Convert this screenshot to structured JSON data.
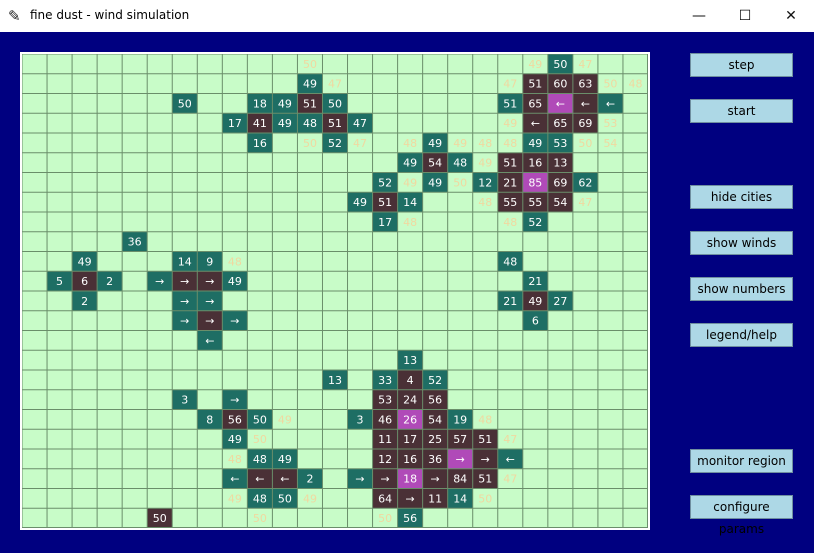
{
  "window": {
    "title": "fine dust - wind simulation",
    "icon": "feather-icon",
    "controls": [
      "minimize-icon",
      "maximize-icon",
      "close-icon"
    ]
  },
  "buttons": {
    "step": "step",
    "start": "start",
    "hide_cities": "hide cities",
    "show_winds": "show winds",
    "show_numbers": "show numbers",
    "legend_help": "legend/help",
    "monitor_region": "monitor region",
    "configure_params": "configure params"
  },
  "grid": {
    "rows": 19,
    "cols": 25,
    "colors": {
      "empty": "#c8fcc8",
      "teal": "#1e6e64",
      "dark": "#4a3036",
      "magenta": "#b04ab8",
      "line": "#6a8e6a",
      "text": "#ffffff",
      "faint": "#f0d8a0"
    },
    "cells": [
      [
        0,
        11,
        "f",
        "50"
      ],
      [
        0,
        20,
        "f",
        "49"
      ],
      [
        0,
        21,
        "t",
        "50"
      ],
      [
        0,
        22,
        "f",
        "47"
      ],
      [
        1,
        11,
        "t",
        "49"
      ],
      [
        1,
        12,
        "f",
        "47"
      ],
      [
        1,
        19,
        "f",
        "47"
      ],
      [
        1,
        20,
        "d",
        "51"
      ],
      [
        1,
        21,
        "d",
        "60"
      ],
      [
        1,
        22,
        "d",
        "63"
      ],
      [
        1,
        23,
        "f",
        "50"
      ],
      [
        1,
        24,
        "f",
        "48"
      ],
      [
        2,
        6,
        "t",
        "50"
      ],
      [
        2,
        9,
        "t",
        "18"
      ],
      [
        2,
        10,
        "t",
        "49"
      ],
      [
        2,
        11,
        "d",
        "51"
      ],
      [
        2,
        12,
        "t",
        "50"
      ],
      [
        2,
        19,
        "t",
        "51"
      ],
      [
        2,
        20,
        "d",
        "65"
      ],
      [
        2,
        21,
        "m",
        "←"
      ],
      [
        2,
        22,
        "d",
        "←"
      ],
      [
        2,
        23,
        "t",
        "←"
      ],
      [
        3,
        8,
        "t",
        "17"
      ],
      [
        3,
        9,
        "d",
        "41"
      ],
      [
        3,
        10,
        "t",
        "49"
      ],
      [
        3,
        11,
        "t",
        "48"
      ],
      [
        3,
        12,
        "d",
        "51"
      ],
      [
        3,
        13,
        "t",
        "47"
      ],
      [
        3,
        19,
        "f",
        "49"
      ],
      [
        3,
        20,
        "d",
        "←"
      ],
      [
        3,
        21,
        "d",
        "65"
      ],
      [
        3,
        22,
        "d",
        "69"
      ],
      [
        3,
        23,
        "f",
        "53"
      ],
      [
        4,
        9,
        "t",
        "16"
      ],
      [
        4,
        11,
        "f",
        "50"
      ],
      [
        4,
        12,
        "t",
        "52"
      ],
      [
        4,
        13,
        "f",
        "47"
      ],
      [
        4,
        15,
        "f",
        "48"
      ],
      [
        4,
        16,
        "t",
        "49"
      ],
      [
        4,
        17,
        "f",
        "49"
      ],
      [
        4,
        18,
        "f",
        "48"
      ],
      [
        4,
        19,
        "f",
        "48"
      ],
      [
        4,
        20,
        "t",
        "49"
      ],
      [
        4,
        21,
        "t",
        "53"
      ],
      [
        4,
        22,
        "f",
        "50"
      ],
      [
        4,
        23,
        "f",
        "54"
      ],
      [
        5,
        15,
        "t",
        "49"
      ],
      [
        5,
        16,
        "d",
        "54"
      ],
      [
        5,
        17,
        "t",
        "48"
      ],
      [
        5,
        18,
        "f",
        "49"
      ],
      [
        5,
        19,
        "d",
        "51"
      ],
      [
        5,
        20,
        "d",
        "16"
      ],
      [
        5,
        21,
        "d",
        "13"
      ],
      [
        6,
        14,
        "t",
        "52"
      ],
      [
        6,
        15,
        "f",
        "49"
      ],
      [
        6,
        16,
        "t",
        "49"
      ],
      [
        6,
        17,
        "f",
        "50"
      ],
      [
        6,
        18,
        "t",
        "12"
      ],
      [
        6,
        19,
        "d",
        "21"
      ],
      [
        6,
        20,
        "m",
        "85"
      ],
      [
        6,
        21,
        "d",
        "69"
      ],
      [
        6,
        22,
        "t",
        "62"
      ],
      [
        7,
        13,
        "t",
        "49"
      ],
      [
        7,
        14,
        "d",
        "51"
      ],
      [
        7,
        15,
        "t",
        "14"
      ],
      [
        7,
        18,
        "f",
        "48"
      ],
      [
        7,
        19,
        "d",
        "55"
      ],
      [
        7,
        20,
        "d",
        "55"
      ],
      [
        7,
        21,
        "d",
        "54"
      ],
      [
        7,
        22,
        "f",
        "47"
      ],
      [
        8,
        14,
        "t",
        "17"
      ],
      [
        8,
        15,
        "f",
        "48"
      ],
      [
        8,
        19,
        "f",
        "48"
      ],
      [
        8,
        20,
        "t",
        "52"
      ],
      [
        9,
        4,
        "t",
        "36"
      ],
      [
        10,
        2,
        "t",
        "49"
      ],
      [
        10,
        6,
        "t",
        "14"
      ],
      [
        10,
        7,
        "t",
        "9"
      ],
      [
        10,
        8,
        "f",
        "48"
      ],
      [
        10,
        19,
        "t",
        "48"
      ],
      [
        11,
        1,
        "t",
        "5"
      ],
      [
        11,
        2,
        "d",
        "6"
      ],
      [
        11,
        3,
        "t",
        "2"
      ],
      [
        11,
        5,
        "t",
        "→"
      ],
      [
        11,
        6,
        "d",
        "→"
      ],
      [
        11,
        7,
        "d",
        "→"
      ],
      [
        11,
        8,
        "t",
        "49"
      ],
      [
        11,
        20,
        "t",
        "21"
      ],
      [
        12,
        2,
        "t",
        "2"
      ],
      [
        12,
        6,
        "t",
        "→"
      ],
      [
        12,
        7,
        "t",
        "→"
      ],
      [
        12,
        19,
        "t",
        "21"
      ],
      [
        12,
        20,
        "d",
        "49"
      ],
      [
        12,
        21,
        "t",
        "27"
      ],
      [
        13,
        6,
        "t",
        "→"
      ],
      [
        13,
        7,
        "d",
        "→"
      ],
      [
        13,
        8,
        "t",
        "→"
      ],
      [
        13,
        20,
        "t",
        "6"
      ],
      [
        14,
        7,
        "t",
        "←"
      ],
      [
        15,
        15,
        "t",
        "13"
      ],
      [
        16,
        12,
        "t",
        "13"
      ],
      [
        16,
        14,
        "t",
        "33"
      ],
      [
        16,
        15,
        "d",
        "4"
      ],
      [
        16,
        16,
        "t",
        "52"
      ],
      [
        17,
        6,
        "t",
        "3"
      ],
      [
        17,
        8,
        "t",
        "→"
      ],
      [
        17,
        14,
        "d",
        "53"
      ],
      [
        17,
        15,
        "d",
        "24"
      ],
      [
        17,
        16,
        "d",
        "56"
      ],
      [
        18,
        7,
        "t",
        "8"
      ],
      [
        18,
        8,
        "d",
        "56"
      ],
      [
        18,
        9,
        "t",
        "50"
      ],
      [
        18,
        10,
        "f",
        "49"
      ],
      [
        18,
        13,
        "t",
        "3"
      ],
      [
        18,
        14,
        "d",
        "46"
      ],
      [
        18,
        15,
        "m",
        "26"
      ],
      [
        18,
        16,
        "d",
        "54"
      ],
      [
        18,
        17,
        "t",
        "19"
      ],
      [
        18,
        18,
        "f",
        "48"
      ]
    ],
    "extra_rows": [
      [
        19,
        8,
        "t",
        "49"
      ],
      [
        19,
        9,
        "f",
        "50"
      ],
      [
        19,
        14,
        "d",
        "11"
      ],
      [
        19,
        15,
        "d",
        "17"
      ],
      [
        19,
        16,
        "d",
        "25"
      ],
      [
        19,
        17,
        "d",
        "57"
      ],
      [
        19,
        18,
        "d",
        "51"
      ],
      [
        19,
        19,
        "f",
        "47"
      ],
      [
        20,
        8,
        "f",
        "48"
      ],
      [
        20,
        9,
        "t",
        "48"
      ],
      [
        20,
        10,
        "t",
        "49"
      ],
      [
        20,
        14,
        "d",
        "12"
      ],
      [
        20,
        15,
        "d",
        "16"
      ],
      [
        20,
        16,
        "d",
        "36"
      ],
      [
        20,
        17,
        "m",
        "→"
      ],
      [
        20,
        18,
        "d",
        "→"
      ],
      [
        20,
        19,
        "t",
        "←"
      ],
      [
        21,
        8,
        "t",
        "←"
      ],
      [
        21,
        9,
        "d",
        "←"
      ],
      [
        21,
        10,
        "d",
        "←"
      ],
      [
        21,
        11,
        "t",
        "2"
      ],
      [
        21,
        13,
        "t",
        "→"
      ],
      [
        21,
        14,
        "d",
        "→"
      ],
      [
        21,
        15,
        "m",
        "18"
      ],
      [
        21,
        16,
        "d",
        "→"
      ],
      [
        21,
        17,
        "d",
        "84"
      ],
      [
        21,
        18,
        "d",
        "51"
      ],
      [
        21,
        19,
        "f",
        "47"
      ],
      [
        22,
        8,
        "f",
        "49"
      ],
      [
        22,
        9,
        "t",
        "48"
      ],
      [
        22,
        10,
        "t",
        "50"
      ],
      [
        22,
        11,
        "f",
        "49"
      ],
      [
        22,
        14,
        "d",
        "64"
      ],
      [
        22,
        15,
        "d",
        "→"
      ],
      [
        22,
        16,
        "d",
        "11"
      ],
      [
        22,
        17,
        "t",
        "14"
      ],
      [
        22,
        18,
        "f",
        "50"
      ],
      [
        23,
        5,
        "d",
        "50"
      ],
      [
        23,
        9,
        "f",
        "50"
      ],
      [
        23,
        14,
        "f",
        "50"
      ],
      [
        23,
        15,
        "t",
        "56"
      ]
    ]
  }
}
